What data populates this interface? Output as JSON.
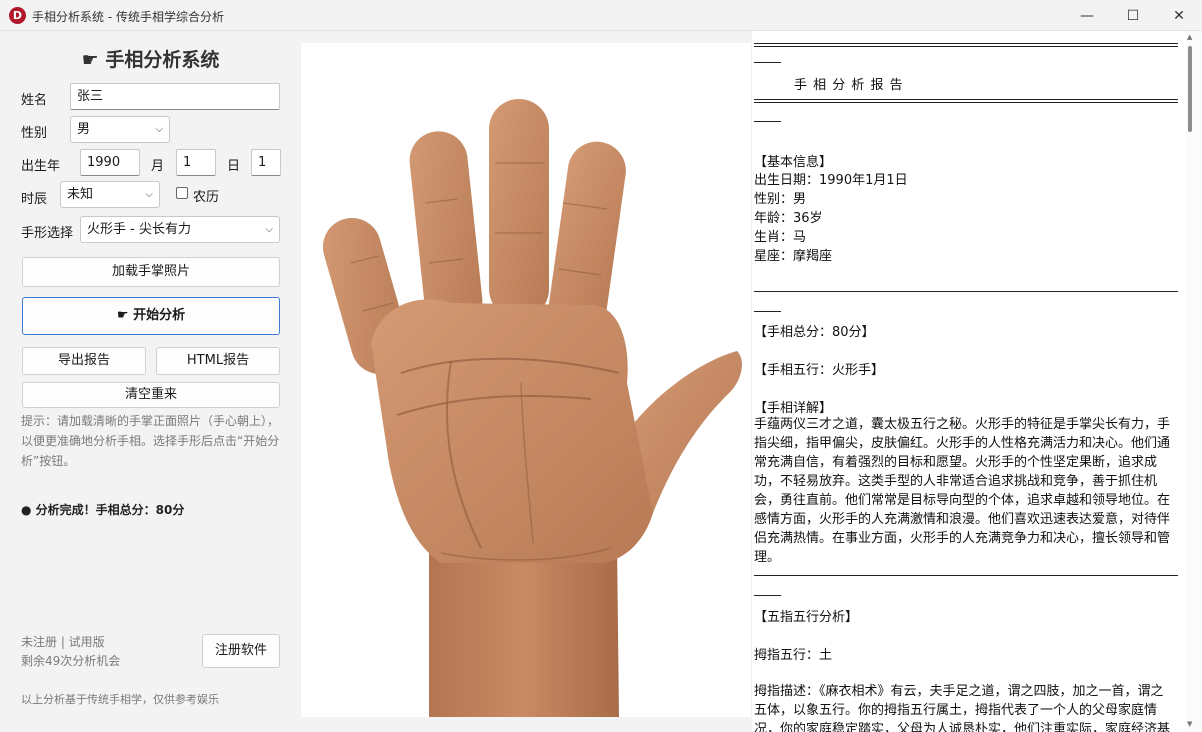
{
  "window": {
    "title": "手相分析系统 - 传统手相学综合分析",
    "icon_letter": "D",
    "minimize": "—",
    "maximize": "☐",
    "close": "✕"
  },
  "left": {
    "app_title": "☛ 手相分析系统",
    "name_label": "姓名",
    "name_value": "张三",
    "gender_label": "性别",
    "gender_value": "男",
    "birth_year_label": "出生年",
    "year_value": "1990",
    "month_label": "月",
    "month_value": "1",
    "day_label": "日",
    "day_value": "1",
    "hour_label": "时辰",
    "hour_value": "未知",
    "lunar_label": "农历",
    "hand_label": "手形选择",
    "hand_value": "火形手 - 尖长有力",
    "load_button": "加载手掌照片",
    "analyze_button": "☛ 开始分析",
    "export_button": "导出报告",
    "html_button": "HTML报告",
    "clear_button": "清空重来",
    "hint": "提示：请加载清晰的手掌正面照片（手心朝上），以便更准确地分析手相。选择手形后点击“开始分析”按钮。",
    "status": "● 分析完成！手相总分：80分",
    "reg_status": "未注册 | 试用版",
    "reg_count": "剩余49次分析机会",
    "register_button": "注册软件",
    "disclaimer": "以上分析基于传统手相学，仅供参考娱乐"
  },
  "report": {
    "double_rule": "════",
    "title": "手 相 分 析 报 告",
    "basic_header": "【基本信息】",
    "birth": "出生日期：1990年1月1日",
    "gender": "性别：男",
    "age": "年龄：36岁",
    "zodiac": "生肖：马",
    "constellation": "星座：摩羯座",
    "score": "【手相总分：80分】",
    "element": "【手相五行：火形手】",
    "detail_header": "【手相详解】",
    "detail_text": "手蕴两仪三才之道，囊太极五行之秘。火形手的特征是手掌尖长有力，手指尖细，指甲偏尖，皮肤偏红。火形手的人性格充满活力和决心。他们通常充满自信，有着强烈的目标和愿望。火形手的个性坚定果断，追求成功，不轻易放弃。这类手型的人非常适合追求挑战和竞争，善于抓住机会，勇往直前。他们常常是目标导向型的个体，追求卓越和领导地位。在感情方面，火形手的人充满激情和浪漫。他们喜欢迅速表达爱意，对待伴侣充满热情。在事业方面，火形手的人充满竞争力和决心，擅长领导和管理。",
    "finger_header": "【五指五行分析】",
    "thumb_element": "拇指五行：土",
    "thumb_desc": "拇指描述：《麻衣相术》有云，夫手足之道，谓之四肢，加之一首，谓之五体，以象五行。你的拇指五行属土，拇指代表了一个人的父母家庭情况，你的家庭稳定踏实，父母为人诚恳朴实，他们注重实际，家庭经济基础"
  },
  "colors": {
    "accent": "#3c7bd6",
    "icon_red": "#b2182b",
    "skin": "#c98e68"
  }
}
